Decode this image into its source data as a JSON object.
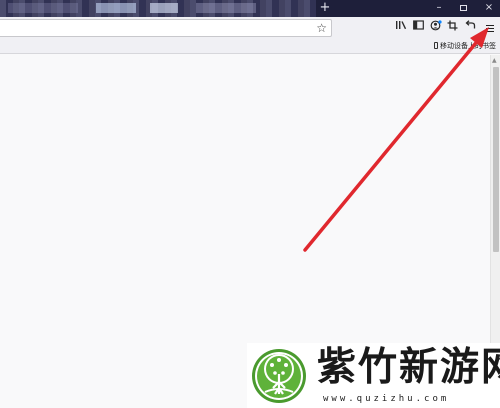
{
  "tabs": {
    "new_tab_label": "+"
  },
  "window_controls": {
    "minimize": "–",
    "close": "×"
  },
  "toolbar": {
    "icons": [
      "library-icon",
      "sidebar-icon",
      "account-icon",
      "screenshot-icon",
      "back-icon",
      "menu-icon"
    ],
    "star": "☆"
  },
  "bookmarks": {
    "mobile_label": "移动设备上的书签"
  },
  "annotation": {
    "arrow_color": "#e0282e"
  },
  "watermark": {
    "title": "紫竹新游网",
    "url": "www.quzizhu.com",
    "brand_color": "#4a9a2e"
  }
}
